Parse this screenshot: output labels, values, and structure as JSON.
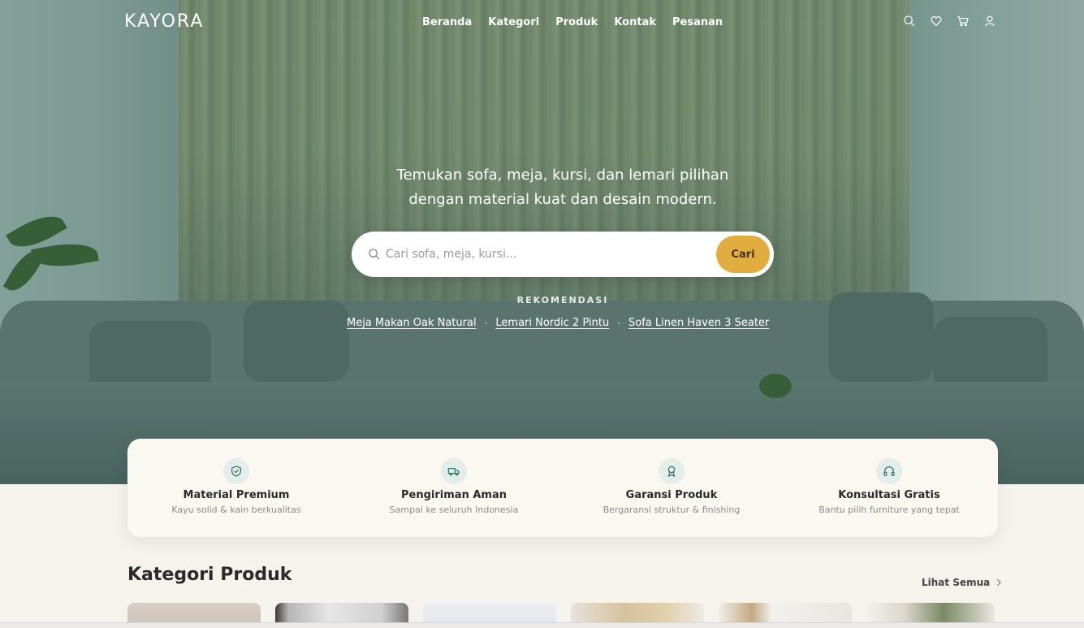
{
  "brand": {
    "logo": "KAYORA"
  },
  "nav": {
    "links": [
      "Beranda",
      "Kategori",
      "Produk",
      "Kontak",
      "Pesanan"
    ],
    "icons": [
      "search-icon",
      "heart-icon",
      "cart-icon",
      "user-icon"
    ]
  },
  "hero": {
    "tagline_line1": "Temukan sofa, meja, kursi, dan lemari pilihan",
    "tagline_line2": "dengan material kuat dan desain modern.",
    "search": {
      "placeholder": "Cari sofa, meja, kursi...",
      "button": "Cari"
    },
    "recommendation_label": "REKOMENDASI",
    "recommendations": [
      "Meja Makan Oak Natural",
      "Lemari Nordic 2 Pintu",
      "Sofa Linen Haven 3 Seater"
    ]
  },
  "features": [
    {
      "icon": "shield-check-icon",
      "title": "Material Premium",
      "subtitle": "Kayu solid & kain berkualitas"
    },
    {
      "icon": "truck-icon",
      "title": "Pengiriman Aman",
      "subtitle": "Sampai ke seluruh Indonesia"
    },
    {
      "icon": "award-icon",
      "title": "Garansi Produk",
      "subtitle": "Bergaransi struktur & finishing"
    },
    {
      "icon": "headphones-icon",
      "title": "Konsultasi Gratis",
      "subtitle": "Bantu pilih furniture yang tepat"
    }
  ],
  "categories": {
    "title": "Kategori Produk",
    "see_all": "Lihat Semua"
  },
  "colors": {
    "accent": "#e0ad3e",
    "icon_teal": "#2f6e64",
    "background": "#f6f2ec"
  }
}
